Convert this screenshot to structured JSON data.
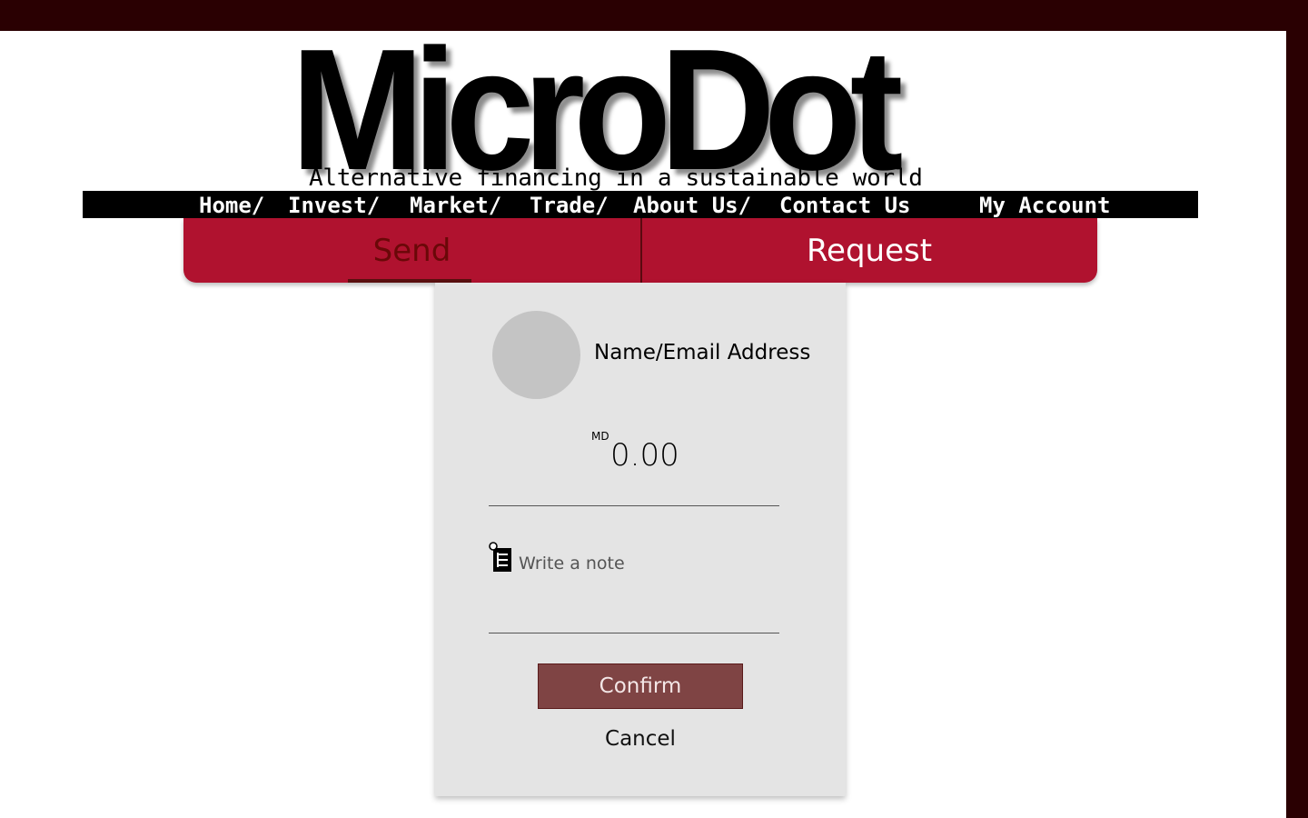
{
  "brand": {
    "logo_text": "MicroDot",
    "tagline": "Alternative financing in a sustainable world"
  },
  "nav": {
    "items": [
      "Home/",
      "Invest/",
      "Market/",
      "Trade/",
      "About Us/",
      "Contact Us",
      "My Account"
    ]
  },
  "tabs": {
    "send_label": "Send",
    "request_label": "Request",
    "active": "Send"
  },
  "form": {
    "recipient_placeholder": "Name/Email Address",
    "currency": "MD",
    "amount": "0.00",
    "note_placeholder": "Write a note",
    "confirm_label": "Confirm",
    "cancel_label": "Cancel"
  },
  "colors": {
    "frame": "#2a0002",
    "tab_bar": "#b0122f",
    "confirm_button": "#7f4444",
    "card": "#e4e4e4"
  },
  "icons": {
    "note": "notepad-icon"
  }
}
